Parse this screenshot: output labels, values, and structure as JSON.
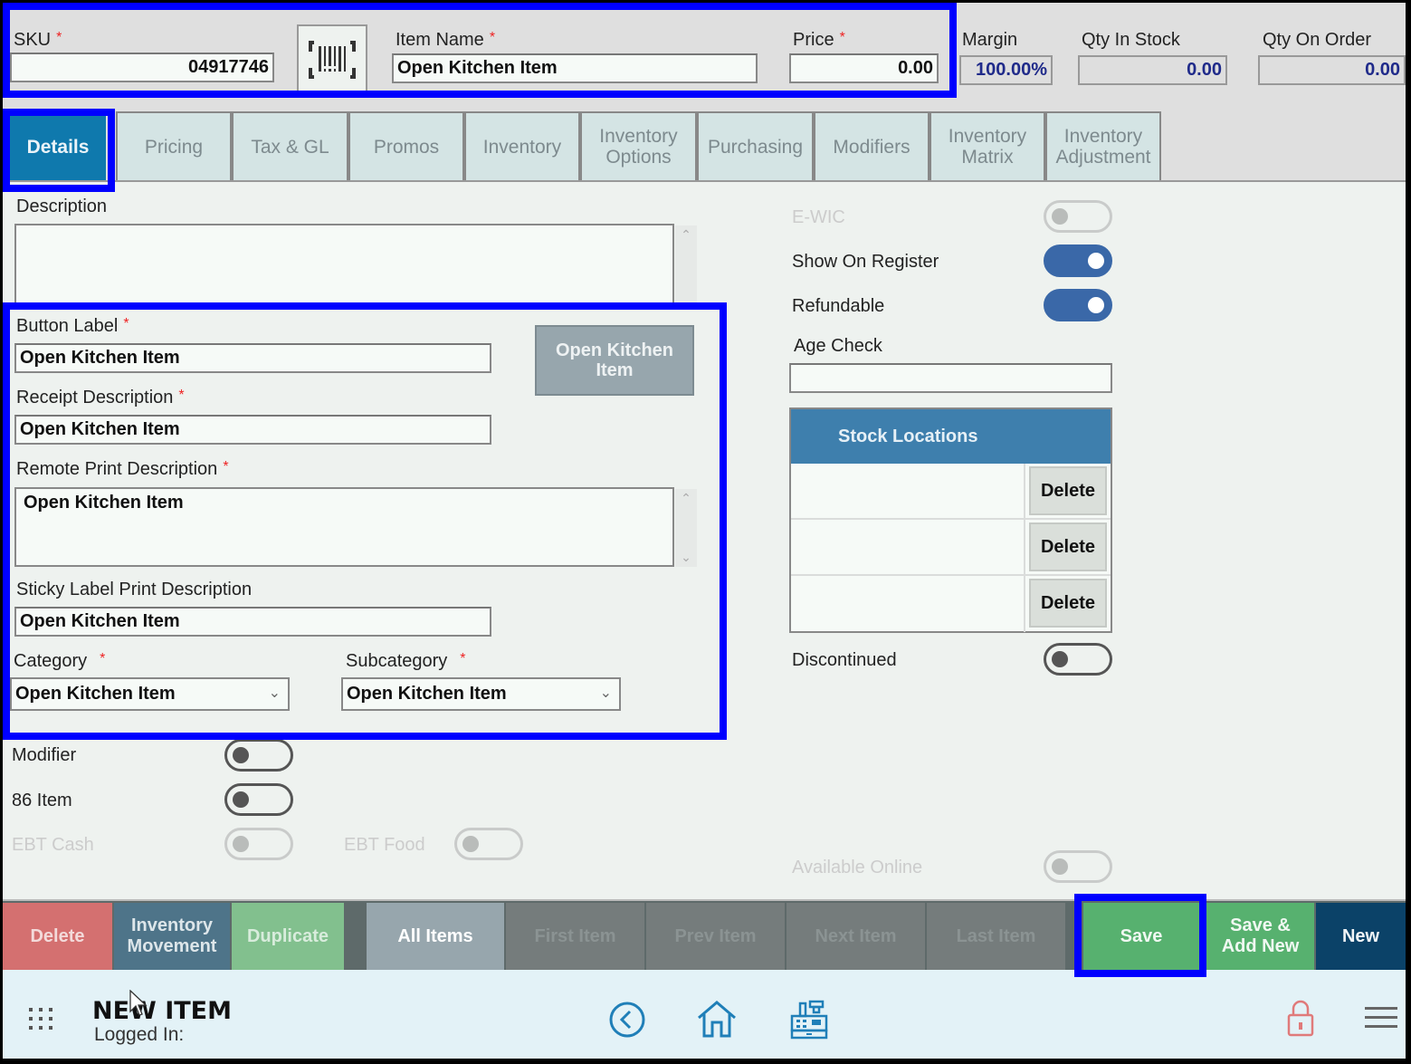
{
  "header": {
    "sku": {
      "label": "SKU",
      "required": "*",
      "value": "04917746"
    },
    "barcode_icon": "barcode-scan-icon",
    "item_name": {
      "label": "Item Name",
      "required": "*",
      "value": "Open Kitchen Item"
    },
    "price": {
      "label": "Price",
      "required": "*",
      "value": "0.00"
    },
    "margin": {
      "label": "Margin",
      "value": "100.00%"
    },
    "qty_in_stock": {
      "label": "Qty In Stock",
      "value": "0.00"
    },
    "qty_on_order": {
      "label": "Qty On Order",
      "value": "0.00"
    }
  },
  "tabs": [
    {
      "label": "Details",
      "active": true
    },
    {
      "label": "Pricing"
    },
    {
      "label": "Tax & GL"
    },
    {
      "label": "Promos"
    },
    {
      "label": "Inventory"
    },
    {
      "label": "Inventory Options"
    },
    {
      "label": "Purchasing"
    },
    {
      "label": "Modifiers"
    },
    {
      "label": "Inventory Matrix"
    },
    {
      "label": "Inventory Adjustment"
    }
  ],
  "details": {
    "description": {
      "label": "Description",
      "value": ""
    },
    "button_label": {
      "label": "Button Label",
      "required": "*",
      "value": "Open Kitchen Item"
    },
    "button_preview": "Open Kitchen Item",
    "receipt_description": {
      "label": "Receipt Description",
      "required": "*",
      "value": "Open Kitchen Item"
    },
    "remote_print_description": {
      "label": "Remote Print Description",
      "required": "*",
      "value": "Open Kitchen Item"
    },
    "sticky_label": {
      "label": "Sticky Label Print Description",
      "value": "Open Kitchen Item"
    },
    "category": {
      "label": "Category",
      "required": "*",
      "value": "Open Kitchen Item"
    },
    "subcategory": {
      "label": "Subcategory",
      "required": "*",
      "value": "Open Kitchen Item"
    },
    "modifier": {
      "label": "Modifier",
      "on": false
    },
    "item86": {
      "label": "86 Item",
      "on": false
    },
    "ebt_cash": {
      "label": "EBT Cash",
      "on": false,
      "disabled": true
    },
    "ebt_food": {
      "label": "EBT Food",
      "on": false,
      "disabled": true
    }
  },
  "right_panel": {
    "ewic": {
      "label": "E-WIC",
      "on": false,
      "disabled": true
    },
    "show_on_register": {
      "label": "Show On Register",
      "on": true
    },
    "refundable": {
      "label": "Refundable",
      "on": true
    },
    "age_check": {
      "label": "Age Check",
      "value": ""
    },
    "stock_locations": {
      "title": "Stock Locations",
      "rows": [
        {
          "location": "",
          "delete_label": "Delete"
        },
        {
          "location": "",
          "delete_label": "Delete"
        },
        {
          "location": "",
          "delete_label": "Delete"
        }
      ]
    },
    "discontinued": {
      "label": "Discontinued",
      "on": false
    },
    "available_online": {
      "label": "Available Online",
      "on": false,
      "disabled": true
    }
  },
  "actions": {
    "delete": "Delete",
    "inventory_movement": "Inventory Movement",
    "duplicate": "Duplicate",
    "all_items": "All Items",
    "first_item": "First Item",
    "prev_item": "Prev Item",
    "next_item": "Next Item",
    "last_item": "Last Item",
    "save": "Save",
    "save_add_new": "Save & Add New",
    "new": "New"
  },
  "footer": {
    "title": "NEW ITEM",
    "logged_in": "Logged In:",
    "icons": [
      "apps-grid-icon",
      "back-circle-icon",
      "home-icon",
      "cash-register-icon",
      "lock-icon",
      "hamburger-menu-icon"
    ]
  },
  "colors": {
    "accent_blue": "#0f79ad",
    "toggle_on": "#3a68a8",
    "stock_header": "#3e7fad",
    "delete": "#d47070",
    "inventory_movement": "#4e7489",
    "duplicate": "#82c08e",
    "all_items": "#97a6ad",
    "nav_disabled": "#757c7c",
    "save": "#57b16f",
    "new": "#0b4268",
    "annotation": "#0000ff"
  }
}
